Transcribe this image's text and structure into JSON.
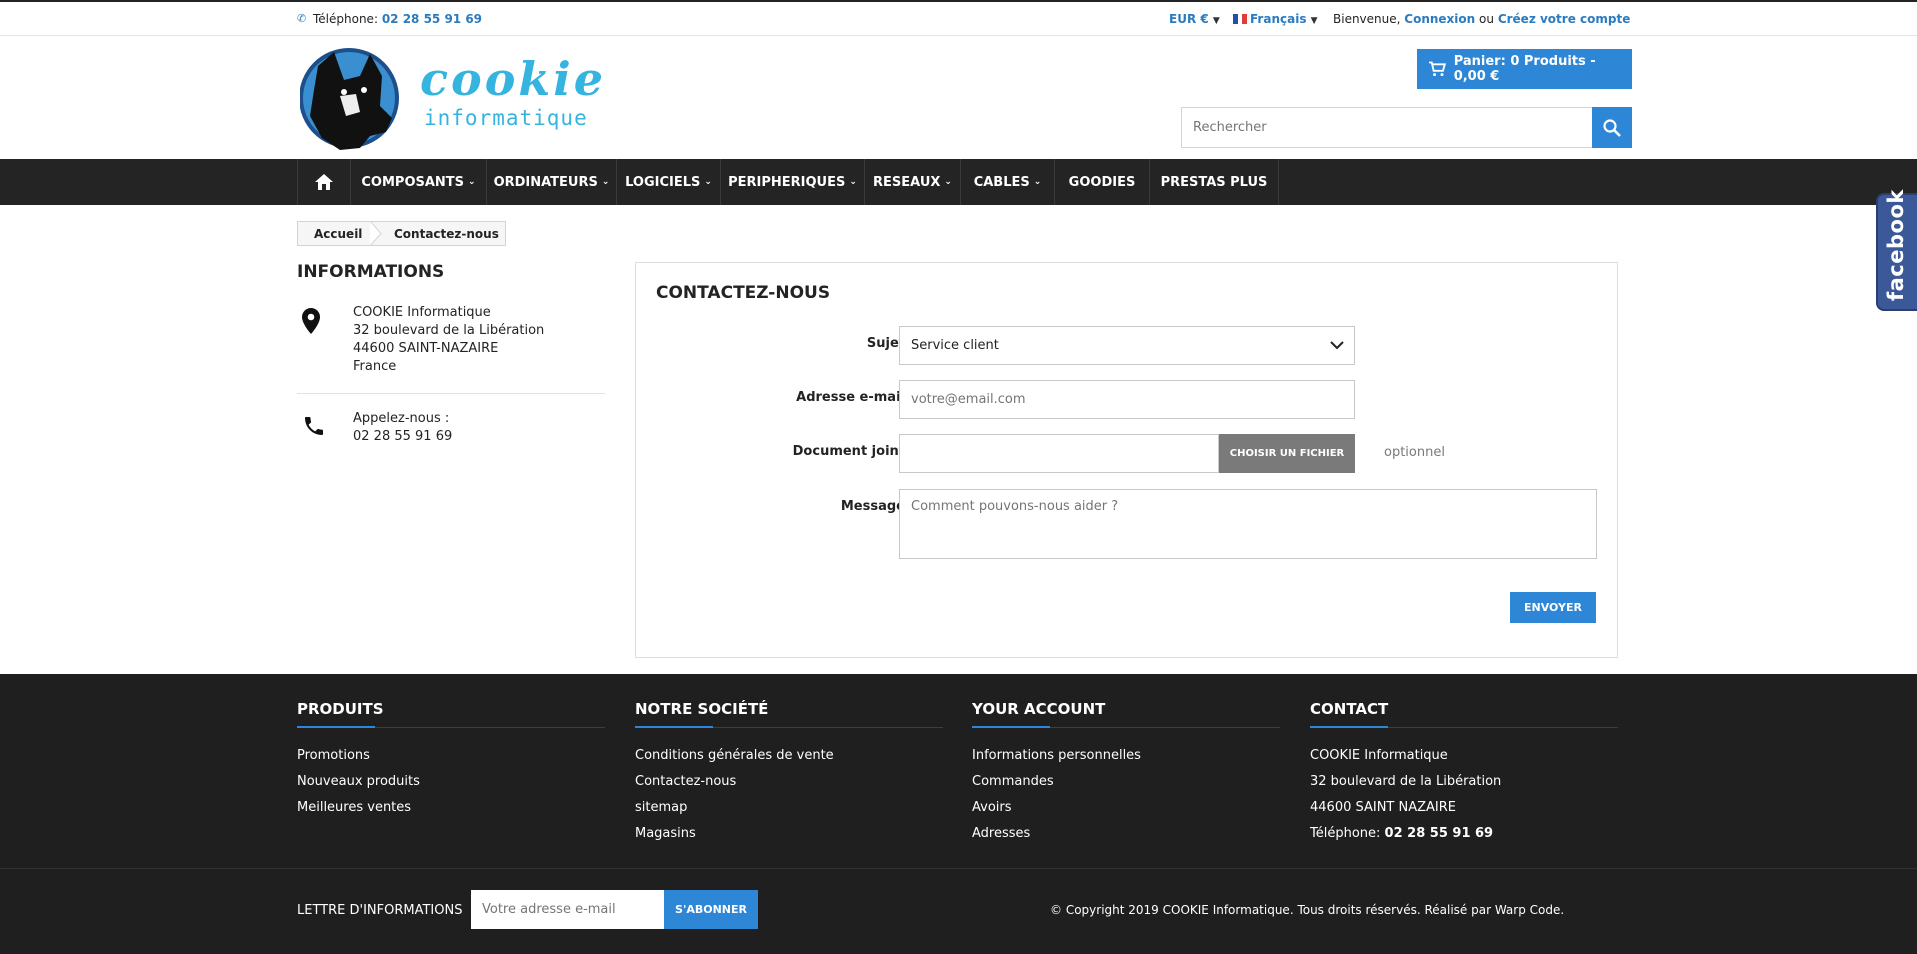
{
  "topbar": {
    "phone_label": "Téléphone:",
    "phone_number": "02 28 55 91 69",
    "currency": "EUR €",
    "language": "Français",
    "welcome": "Bienvenue,",
    "login": "Connexion",
    "or": "ou",
    "register": "Créez votre compte"
  },
  "header": {
    "logo_line1": "cookie",
    "logo_line2": "informatique",
    "cart_label": "Panier: 0 Produits - 0,00 €",
    "search_placeholder": "Rechercher"
  },
  "nav": {
    "items": [
      {
        "label": "COMPOSANTS",
        "dropdown": true
      },
      {
        "label": "ORDINATEURS",
        "dropdown": true
      },
      {
        "label": "LOGICIELS",
        "dropdown": true
      },
      {
        "label": "PERIPHERIQUES",
        "dropdown": true
      },
      {
        "label": "RESEAUX",
        "dropdown": true
      },
      {
        "label": "CABLES",
        "dropdown": true
      },
      {
        "label": "GOODIES",
        "dropdown": false
      },
      {
        "label": "PRESTAS PLUS",
        "dropdown": false
      }
    ]
  },
  "breadcrumb": {
    "home": "Accueil",
    "current": "Contactez-nous"
  },
  "sidebar": {
    "title": "INFORMATIONS",
    "address": [
      "COOKIE Informatique",
      "32 boulevard de la Libération",
      "44600 SAINT-NAZAIRE",
      "France"
    ],
    "call_label": "Appelez-nous :",
    "call_number": "02 28 55 91 69"
  },
  "form": {
    "title": "CONTACTEZ-NOUS",
    "subject_label": "Sujet",
    "subject_value": "Service client",
    "email_label": "Adresse e-mail",
    "email_placeholder": "votre@email.com",
    "attachment_label": "Document joint",
    "choose_file": "CHOISIR UN FICHIER",
    "optional": "optionnel",
    "message_label": "Message",
    "message_placeholder": "Comment pouvons-nous aider ?",
    "send": "ENVOYER"
  },
  "social": {
    "facebook": "facebook"
  },
  "footer": {
    "columns": [
      {
        "title": "PRODUITS",
        "links": [
          "Promotions",
          "Nouveaux produits",
          "Meilleures ventes"
        ]
      },
      {
        "title": "NOTRE SOCIÉTÉ",
        "links": [
          "Conditions générales de vente",
          "Contactez-nous",
          "sitemap",
          "Magasins"
        ]
      },
      {
        "title": "YOUR ACCOUNT",
        "links": [
          "Informations personnelles",
          "Commandes",
          "Avoirs",
          "Adresses"
        ]
      },
      {
        "title": "CONTACT",
        "links": [
          "COOKIE Informatique",
          "32 boulevard de la Libération",
          "44600 SAINT NAZAIRE"
        ]
      }
    ],
    "contact_phone_label": "Téléphone:",
    "contact_phone_number": "02 28 55 91 69",
    "newsletter_label": "LETTRE D'INFORMATIONS",
    "newsletter_placeholder": "Votre adresse e-mail",
    "subscribe": "S'ABONNER",
    "copyright": "© Copyright 2019 COOKIE Informatique. Tous droits réservés. Réalisé par Warp Code."
  },
  "colors": {
    "accent": "#2d87d6",
    "dark": "#242424",
    "link": "#2a7bbf",
    "logo": "#35b4e0"
  }
}
